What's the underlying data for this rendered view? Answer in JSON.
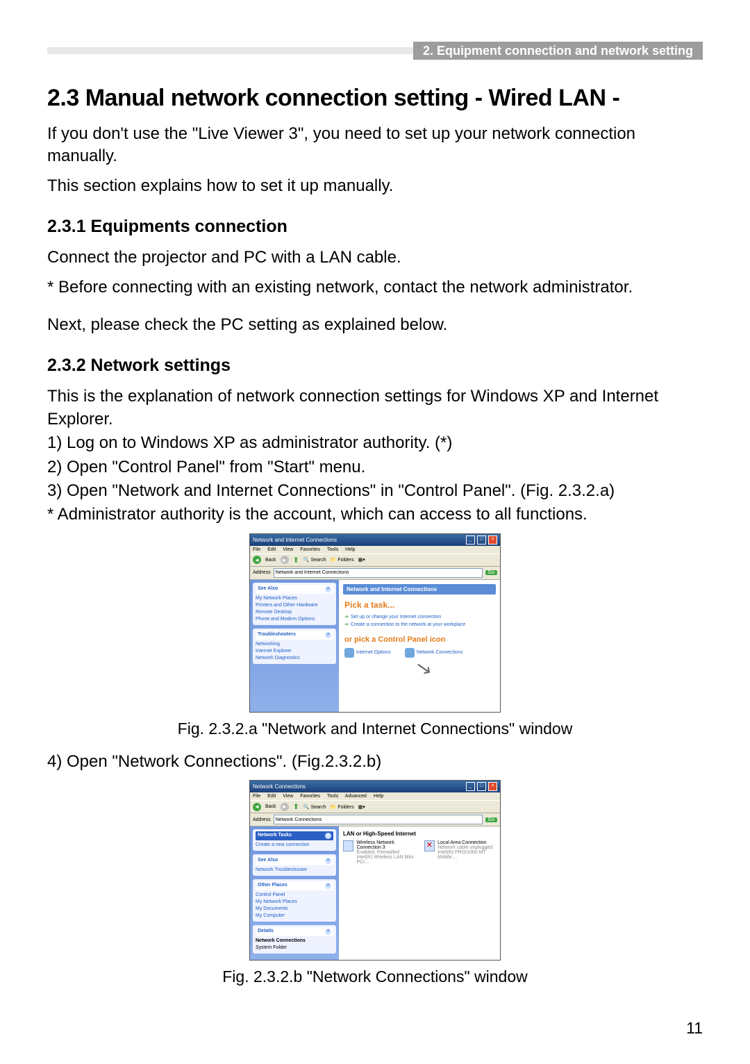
{
  "header": {
    "breadcrumb": "2. Equipment connection and network setting"
  },
  "h1": "2.3 Manual network connection setting - Wired LAN -",
  "intro1": "If you don't use the \"Live Viewer 3\", you need to set up your network connection manually.",
  "intro2": "This section explains how to set it up manually.",
  "h2a": "2.3.1 Equipments connection",
  "p231a": "Connect the projector and PC with a LAN cable.",
  "p231b": "* Before connecting with an existing network, contact the network administrator.",
  "p231c": "Next, please check the PC setting as explained below.",
  "h2b": "2.3.2 Network settings",
  "p232a": "This is the explanation of network connection settings for Windows XP and Internet Explorer.",
  "p232b": "1) Log on to Windows XP as administrator authority. (*)",
  "p232c": "2) Open \"Control Panel\" from \"Start\" menu.",
  "p232d": "3) Open \"Network and Internet Connections\" in \"Control Panel\". (Fig. 2.3.2.a)",
  "p232e": "* Administrator authority is the account, which can access to all functions.",
  "captionA": "Fig. 2.3.2.a \"Network and Internet Connections\" window",
  "p4": "4) Open \"Network Connections\". (Fig.2.3.2.b)",
  "captionB": "Fig. 2.3.2.b \"Network Connections\" window",
  "pageNumber": "11",
  "figA": {
    "title": "Network and Internet Connections",
    "menus": [
      "File",
      "Edit",
      "View",
      "Favorites",
      "Tools",
      "Help"
    ],
    "toolbar": {
      "back": "Back",
      "search": "Search",
      "folders": "Folders"
    },
    "address": "Network and Internet Connections",
    "go": "Go",
    "side": {
      "seeAlso": {
        "title": "See Also",
        "items": [
          "My Network Places",
          "Printers and Other Hardware",
          "Remote Desktop",
          "Phone and Modem Options"
        ]
      },
      "trouble": {
        "title": "Troubleshooters",
        "items": [
          "Networking",
          "Internet Explorer",
          "Network Diagnostics"
        ]
      }
    },
    "content": {
      "heading": "Network and Internet Connections",
      "pick": "Pick a task...",
      "task1": "Set up or change your Internet connection",
      "task2": "Create a connection to the network at your workplace",
      "or": "or pick a Control Panel icon",
      "icon1": "Internet Options",
      "icon2": "Network Connections"
    }
  },
  "figB": {
    "title": "Network Connections",
    "menus": [
      "File",
      "Edit",
      "View",
      "Favorites",
      "Tools",
      "Advanced",
      "Help"
    ],
    "toolbar": {
      "back": "Back",
      "search": "Search",
      "folders": "Folders"
    },
    "address": "Network Connections",
    "go": "Go",
    "side": {
      "tasks": {
        "title": "Network Tasks",
        "items": [
          "Create a new connection"
        ]
      },
      "seeAlso": {
        "title": "See Also",
        "items": [
          "Network Troubleshooter"
        ]
      },
      "other": {
        "title": "Other Places",
        "items": [
          "Control Panel",
          "My Network Places",
          "My Documents",
          "My Computer"
        ]
      },
      "details": {
        "title": "Details",
        "line1": "Network Connections",
        "line2": "System Folder"
      }
    },
    "content": {
      "heading": "LAN or High-Speed Internet",
      "conn1": {
        "name": "Wireless Network Connection 3",
        "status": "Enabled, Firewalled",
        "device": "Intel(R) Wireless LAN Mini PCI..."
      },
      "conn2": {
        "name": "Local Area Connection",
        "status": "Network cable unplugged",
        "device": "Intel(R) PRO/1000 MT Mobile ..."
      }
    }
  }
}
